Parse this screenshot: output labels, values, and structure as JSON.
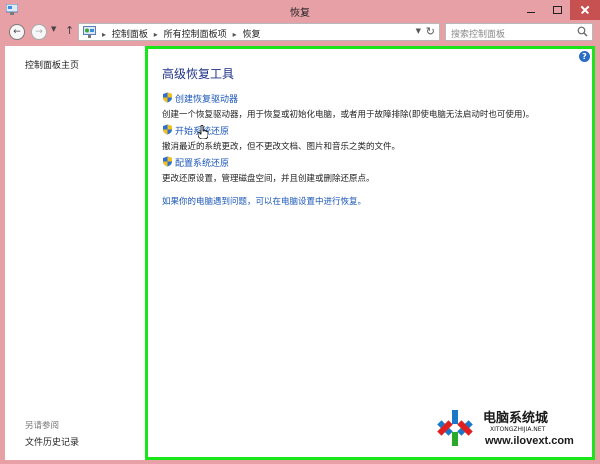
{
  "window": {
    "title": "恢复"
  },
  "nav": {
    "breadcrumbs": [
      "控制面板",
      "所有控制面板项",
      "恢复"
    ],
    "search_placeholder": "搜索控制面板"
  },
  "sidebar": {
    "home_link": "控制面板主页",
    "see_also_label": "另请参阅",
    "file_history_link": "文件历史记录"
  },
  "main": {
    "heading": "高级恢复工具",
    "items": [
      {
        "label": "创建恢复驱动器",
        "description": "创建一个恢复驱动器，用于恢复或初始化电脑，或者用于故障排除(即使电脑无法启动时也可使用)。"
      },
      {
        "label": "开始系统还原",
        "description": "撤消最近的系统更改，但不更改文档、图片和音乐之类的文件。"
      },
      {
        "label": "配置系统还原",
        "description": "更改还原设置，管理磁盘空间，并且创建或删除还原点。"
      }
    ],
    "bottom_link": "如果你的电脑遇到问题，可以在电脑设置中进行恢复。"
  },
  "watermark": {
    "title": "电脑系统城",
    "subtitle": "XITONGZHIJIA.NET",
    "url": "www.ilovext.com"
  },
  "colors": {
    "titlebar": "#e6a0a6",
    "highlight_border": "#19e619",
    "link": "#1a56b8",
    "heading": "#1e3287"
  }
}
